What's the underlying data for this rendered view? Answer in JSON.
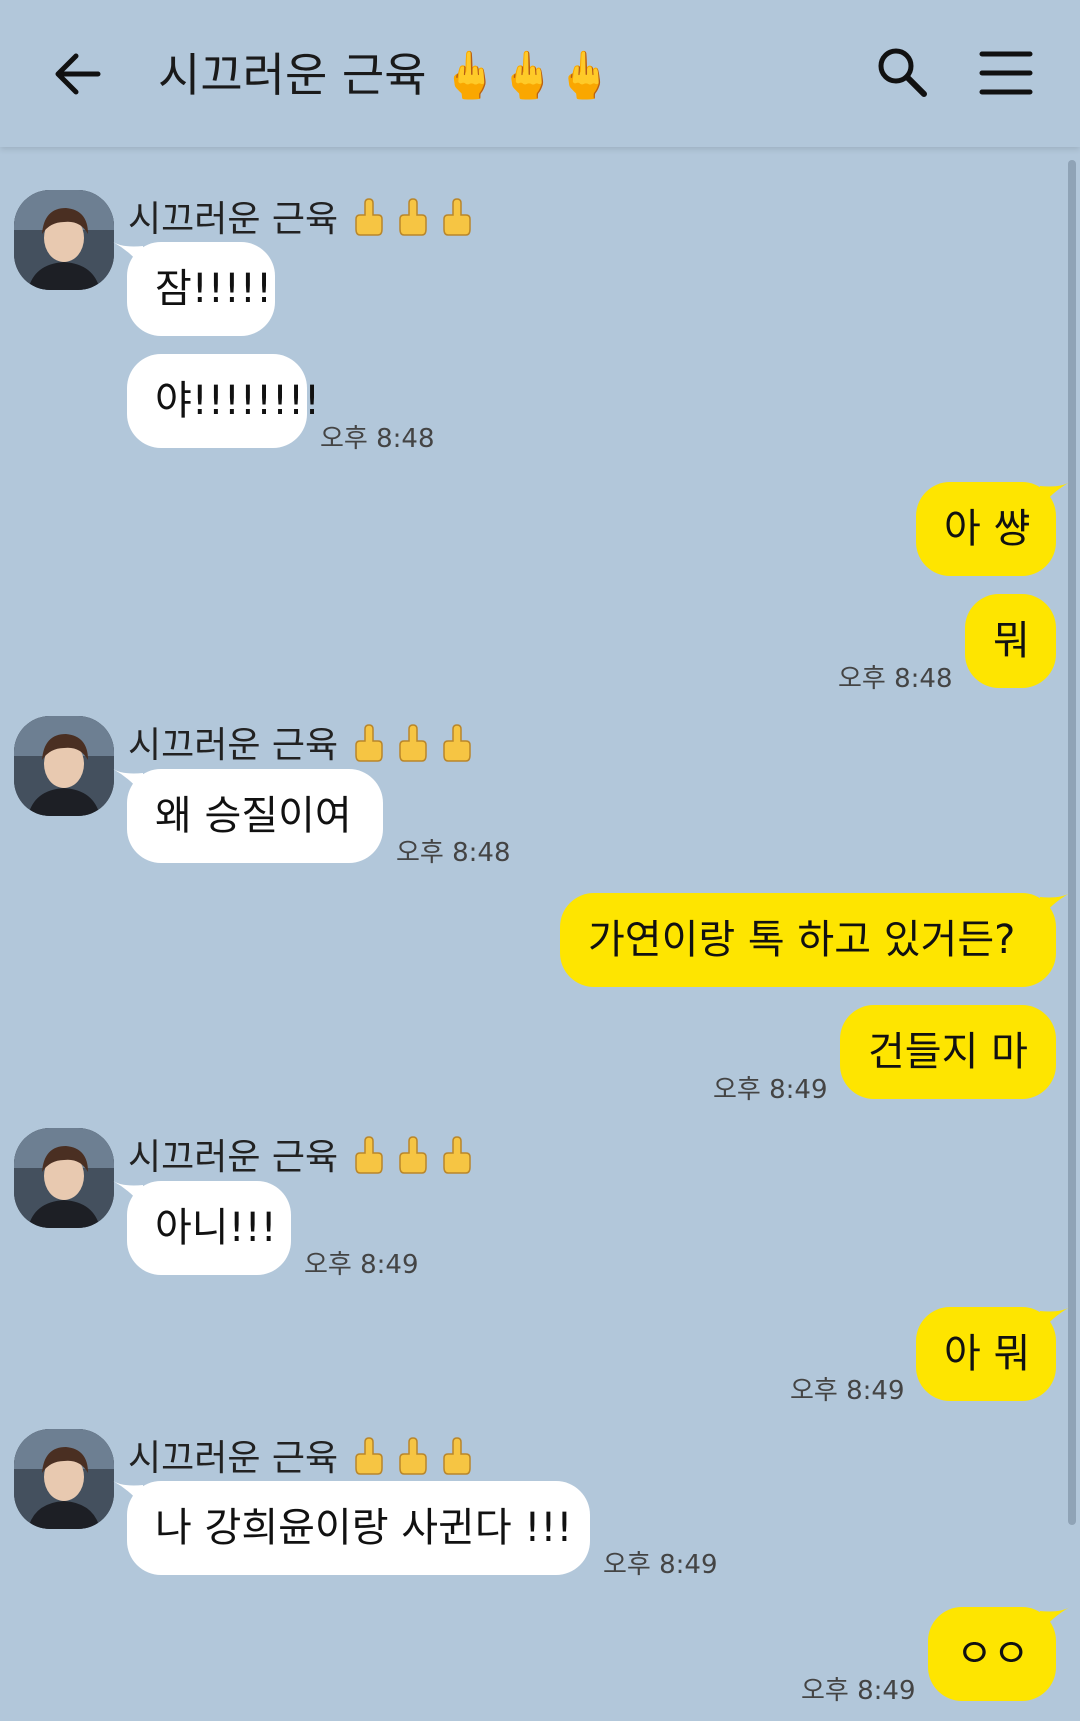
{
  "header": {
    "title": "시끄러운 근육 🖕🖕🖕",
    "back_icon": "back-arrow-icon",
    "search_icon": "search-icon",
    "menu_icon": "menu-icon"
  },
  "contact": {
    "name": "시끄러운 근육"
  },
  "messages": [
    {
      "from": "them",
      "text": "잠!!!!!"
    },
    {
      "from": "them",
      "text": "야!!!!!!!!",
      "time": "오후 8:48"
    },
    {
      "from": "me",
      "text": "아 썅"
    },
    {
      "from": "me",
      "text": "뭐",
      "time": "오후 8:48"
    },
    {
      "from": "them",
      "text": "왜 승질이여",
      "time": "오후 8:48"
    },
    {
      "from": "me",
      "text": "가연이랑 톡 하고 있거든?"
    },
    {
      "from": "me",
      "text": "건들지 마",
      "time": "오후 8:49"
    },
    {
      "from": "them",
      "text": "아니!!!",
      "time": "오후 8:49"
    },
    {
      "from": "me",
      "text": "아 뭐",
      "time": "오후 8:49"
    },
    {
      "from": "them",
      "text": "나 강희윤이랑 사귄다 !!!",
      "time": "오후 8:49"
    },
    {
      "from": "me",
      "text": "ㅇㅇ",
      "time": "오후 8:49"
    }
  ],
  "colors": {
    "background": "#b2c7da",
    "incoming_bubble": "#ffffff",
    "outgoing_bubble": "#fee500"
  }
}
